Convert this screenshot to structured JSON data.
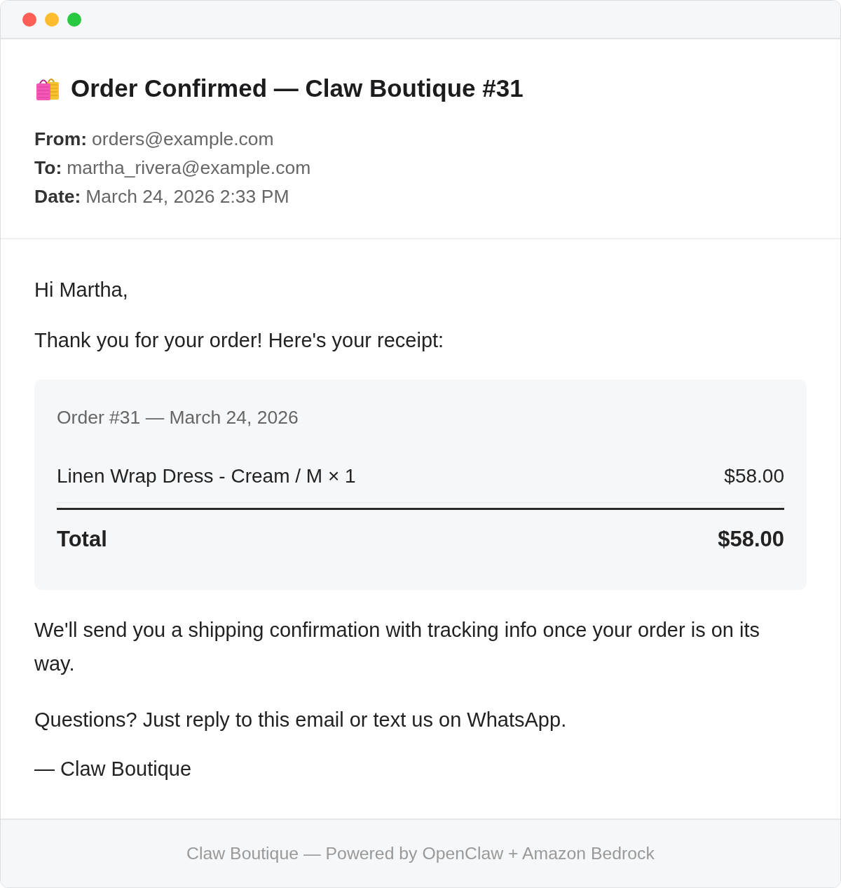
{
  "window": {
    "controls": [
      {
        "color": "#ff5f57"
      },
      {
        "color": "#febc2e"
      },
      {
        "color": "#28c840"
      }
    ]
  },
  "email": {
    "subject": "Order Confirmed — Claw Boutique #31",
    "headers": [
      {
        "label": "From:",
        "value": "orders@example.com"
      },
      {
        "label": "To:",
        "value": "martha_rivera@example.com"
      },
      {
        "label": "Date:",
        "value": "March 24, 2026 2:33 PM"
      }
    ],
    "body": {
      "greeting": "Hi Martha,",
      "intro": "Thank you for your order! Here's your receipt:",
      "receipt": {
        "heading": "Order #31 — March 24, 2026",
        "items": [
          {
            "description": "Linen Wrap Dress - Cream / M × 1",
            "price": "$58.00"
          }
        ],
        "total_label": "Total",
        "total": "$58.00"
      },
      "paragraphs": [
        "We'll send you a shipping confirmation with tracking info once your order is on its way.",
        "Questions? Just reply to this email or text us on WhatsApp."
      ],
      "signature": "— Claw Boutique"
    }
  },
  "footer": {
    "text": "Claw Boutique — Powered by OpenClaw + Amazon Bedrock"
  }
}
